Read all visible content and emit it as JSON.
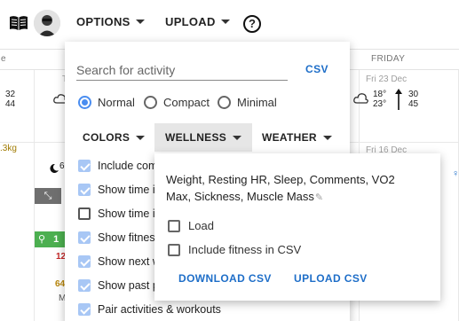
{
  "topbar": {
    "options_label": "OPTIONS",
    "upload_label": "UPLOAD",
    "help_glyph": "?"
  },
  "calendar": {
    "friday_header": "FRIDAY",
    "left_temps": [
      "32",
      "44"
    ],
    "fri_23_date": "Fri 23 Dec",
    "fri_23_temp_min": "18°",
    "fri_23_temp_max": "23°",
    "fri_23_wind_top": "30",
    "fri_23_wind_bottom": "45",
    "fri_16_date": "Fri 16 Dec",
    "weight_text": ".3kg",
    "chip_text": "1",
    "red_num": "12",
    "gold_num": "64",
    "m_letter": "M",
    "moon_digit": "6"
  },
  "options_menu": {
    "search_placeholder": "Search for activity",
    "csv_label": "CSV",
    "view_modes": [
      "Normal",
      "Compact",
      "Minimal"
    ],
    "selected_mode": "Normal",
    "tabs": {
      "colors": "COLORS",
      "wellness": "WELLNESS",
      "weather": "WEATHER"
    },
    "checkboxes": [
      {
        "label": "Include com",
        "checked": true
      },
      {
        "label": "Show time i",
        "checked": true
      },
      {
        "label": "Show time i",
        "checked": false
      },
      {
        "label": "Show fitness",
        "checked": true
      },
      {
        "label": "Show next w",
        "checked": true
      },
      {
        "label": "Show past p",
        "checked": true
      },
      {
        "label": "Pair activities & workouts",
        "checked": true
      }
    ]
  },
  "wellness_panel": {
    "fields_text": "Weight, Resting HR, Sleep, Comments, VO2 Max, Sickness, Muscle Mass",
    "load_label": "Load",
    "include_fitness_label": "Include fitness in CSV",
    "download_label": "DOWNLOAD CSV",
    "upload_label": "UPLOAD CSV"
  },
  "colors": {
    "accent": "#1e6ec8",
    "radio_selected": "#4a8df0",
    "checkbox_checked": "#a8c7f5",
    "green_chip": "#4caf50"
  }
}
